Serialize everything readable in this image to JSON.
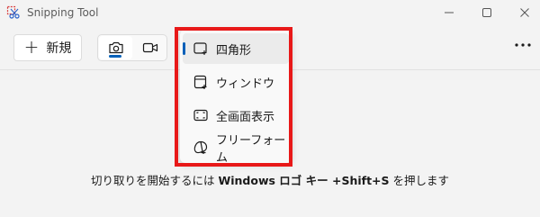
{
  "window": {
    "title": "Snipping Tool"
  },
  "toolbar": {
    "new_label": "新規"
  },
  "snip_modes": [
    {
      "label": "四角形",
      "icon": "rectangle-snip-icon",
      "selected": true
    },
    {
      "label": "ウィンドウ",
      "icon": "window-snip-icon",
      "selected": false
    },
    {
      "label": "全画面表示",
      "icon": "fullscreen-snip-icon",
      "selected": false
    },
    {
      "label": "フリーフォーム",
      "icon": "freeform-snip-icon",
      "selected": false
    }
  ],
  "hint": {
    "prefix": "切り取りを開始するには",
    "keys": "Windows ロゴ キー +Shift+S",
    "suffix": "を押します"
  },
  "colors": {
    "accent": "#005fb8",
    "highlight": "#e81818",
    "background": "#f3f3f3"
  }
}
